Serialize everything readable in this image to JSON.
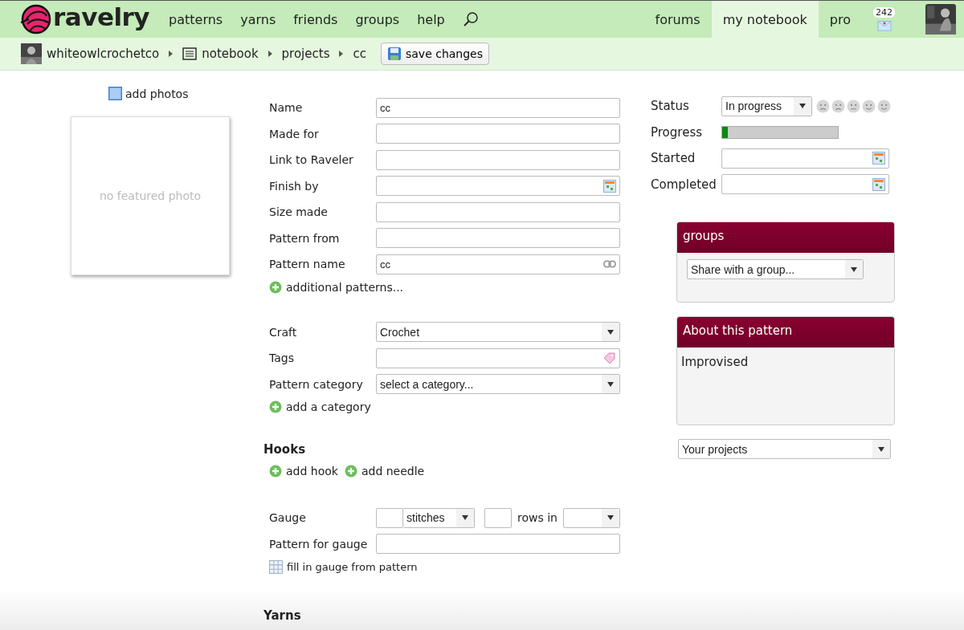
{
  "header": {
    "logo": "ravelry",
    "nav": [
      "patterns",
      "yarns",
      "friends",
      "groups",
      "help"
    ],
    "tabs": [
      {
        "label": "forums",
        "selected": false
      },
      {
        "label": "my notebook",
        "selected": true
      },
      {
        "label": "pro",
        "selected": false
      }
    ],
    "message_count": "242"
  },
  "breadcrumbs": {
    "items": [
      {
        "label": "whiteowlcrochetco",
        "kind": "user"
      },
      {
        "label": "notebook",
        "kind": "notebook"
      },
      {
        "label": "projects",
        "kind": "plain"
      },
      {
        "label": "cc",
        "kind": "plain"
      }
    ],
    "save_button": "save changes"
  },
  "photos": {
    "add_link": "add photos",
    "empty_text": "no featured photo"
  },
  "details": {
    "fields": [
      {
        "label": "Name",
        "kind": "text",
        "value": "cc"
      },
      {
        "label": "Made for",
        "kind": "text"
      },
      {
        "label": "Link to Raveler",
        "kind": "text"
      },
      {
        "label": "Finish by",
        "kind": "date"
      },
      {
        "label": "Size made",
        "kind": "text"
      },
      {
        "label": "Pattern from",
        "kind": "text"
      },
      {
        "label": "Pattern name",
        "kind": "link",
        "value": "cc"
      }
    ],
    "add_link": "additional patterns..."
  },
  "classification": {
    "fields": [
      {
        "label": "Craft",
        "kind": "select",
        "value": "Crochet"
      },
      {
        "label": "Tags",
        "kind": "tags"
      },
      {
        "label": "Pattern category",
        "kind": "select",
        "value": "select a category..."
      }
    ],
    "add_link": "add a category"
  },
  "hooks": {
    "heading": "Hooks",
    "links": [
      "add hook",
      "add needle"
    ]
  },
  "gauge": {
    "label": "Gauge",
    "unit": "stitches",
    "rows_label": "rows in",
    "pattern_label": "Pattern for gauge",
    "fill_link": "fill in gauge from pattern"
  },
  "yarns": {
    "heading": "Yarns"
  },
  "status": {
    "rows": [
      {
        "label": "Status",
        "kind": "select",
        "value": "In progress"
      },
      {
        "label": "Progress",
        "kind": "progress",
        "level": 0.05
      },
      {
        "label": "Started",
        "kind": "date"
      },
      {
        "label": "Completed",
        "kind": "date"
      }
    ]
  },
  "groups_panel": {
    "title": "groups",
    "select": "Share with a group..."
  },
  "about_panel": {
    "title": "About this pattern",
    "text": "Improvised"
  },
  "projects_select": "Your projects"
}
